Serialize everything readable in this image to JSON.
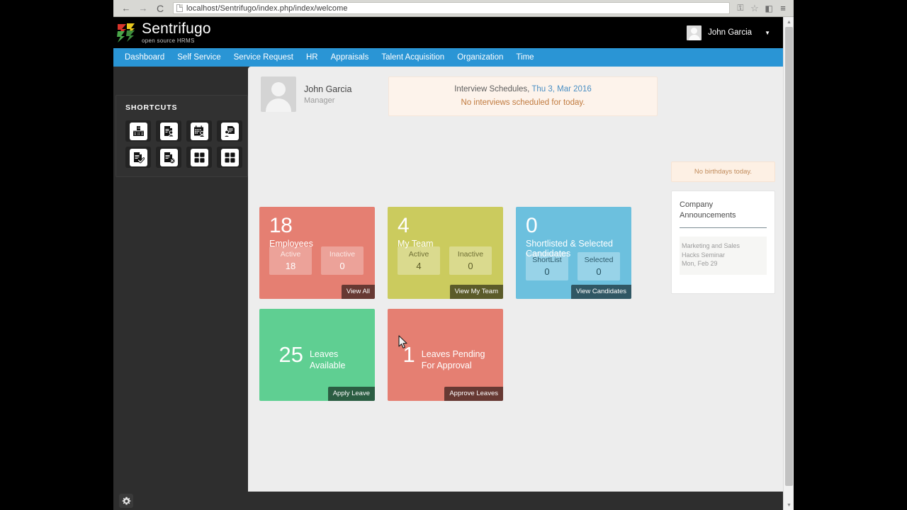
{
  "browser": {
    "url": "localhost/Sentrifugo/index.php/index/welcome",
    "back_icon": "←",
    "forward_icon": "→",
    "reload_icon": "C",
    "key_icon": "⚿",
    "star_icon": "☆",
    "extension_icon": "◧",
    "menu_icon": "≡"
  },
  "header": {
    "logo_title": "Sentrifugo",
    "logo_subtitle": "open source HRMS",
    "user_name": "John Garcia",
    "caret_icon": "▼"
  },
  "nav": {
    "items": [
      {
        "label": "Dashboard"
      },
      {
        "label": "Self Service"
      },
      {
        "label": "Service Request"
      },
      {
        "label": "HR"
      },
      {
        "label": "Appraisals"
      },
      {
        "label": "Talent Acquisition"
      },
      {
        "label": "Organization"
      },
      {
        "label": "Time"
      }
    ]
  },
  "sidebar": {
    "title": "SHORTCUTS",
    "shortcuts": [
      {
        "icon": "org-chart-icon"
      },
      {
        "icon": "document-person-icon"
      },
      {
        "icon": "calendar-person-icon"
      },
      {
        "icon": "person-document-icon"
      },
      {
        "icon": "document-check-icon"
      },
      {
        "icon": "document-cancel-icon"
      },
      {
        "icon": "grid-icon"
      },
      {
        "icon": "grid-icon"
      }
    ]
  },
  "bottom": {
    "gear_icon": "gear-icon"
  },
  "profile": {
    "name": "John Garcia",
    "role": "Manager"
  },
  "interview": {
    "heading": "Interview Schedules,",
    "date": "Thu 3, Mar 2016",
    "message": "No interviews scheduled for today."
  },
  "birthdays": {
    "message": "No birthdays today."
  },
  "announcements": {
    "title": "Company Announcements",
    "items": [
      {
        "line1": "Marketing and Sales",
        "line2": "Hacks Seminar",
        "line3": "Mon, Feb 29"
      }
    ]
  },
  "tiles": [
    {
      "number": "18",
      "caption": "Employees",
      "color": "#e57f72",
      "sub_color": "rgba(255,255,255,0.28)",
      "sub": [
        {
          "label": "Active",
          "value": "18"
        },
        {
          "label": "Inactive",
          "value": "0"
        }
      ],
      "button": "View All"
    },
    {
      "number": "4",
      "caption": "My Team",
      "color": "#cbcb5e",
      "sub_color": "rgba(255,255,255,0.30)",
      "sub": [
        {
          "label": "Active",
          "value": "4"
        },
        {
          "label": "Inactive",
          "value": "0"
        }
      ],
      "button": "View My Team"
    },
    {
      "number": "0",
      "caption": "Shortlisted & Selected Candidates",
      "color": "#6cc0de",
      "sub_color": "rgba(255,255,255,0.30)",
      "sub": [
        {
          "label": "ShortList",
          "value": "0"
        },
        {
          "label": "Selected",
          "value": "0"
        }
      ],
      "button": "View Candidates"
    }
  ],
  "leave_tiles": [
    {
      "number": "25",
      "line1": "Leaves",
      "line2": "Available",
      "color": "#5fcf92",
      "button": "Apply Leave"
    },
    {
      "number": "1",
      "line1": "Leaves Pending",
      "line2": "For Approval",
      "color": "#e57f72",
      "button": "Approve Leaves"
    }
  ],
  "scrollbar": {
    "up_arrow": "▲",
    "down_arrow": "▼"
  }
}
